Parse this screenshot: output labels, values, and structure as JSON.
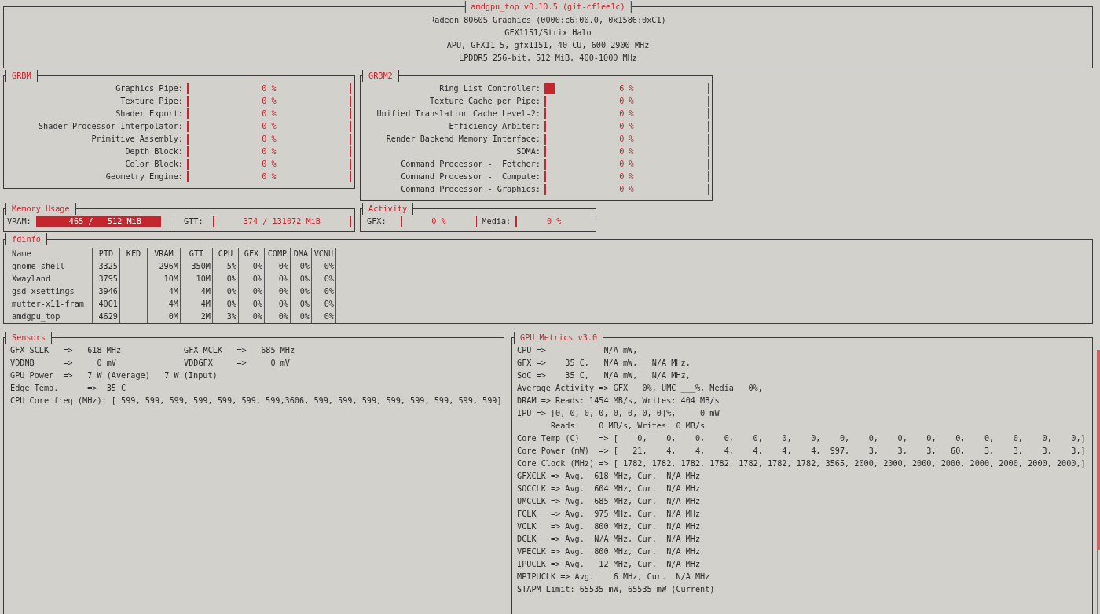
{
  "header": {
    "title": "amdgpu_top v0.10.5 (git-cf1ee1c)",
    "lines": [
      "Radeon 8060S Graphics (0000:c6:00.0, 0x1586:0xC1)",
      "GFX1151/Strix Halo",
      "APU, GFX11_5, gfx1151, 40 CU, 600-2900 MHz",
      "LPDDR5 256-bit, 512 MiB, 400-1000 MHz"
    ]
  },
  "grbm": [
    {
      "title": "GRBM",
      "rows": [
        {
          "label": "Graphics Pipe:",
          "reading": "0 %",
          "level": 0
        },
        {
          "label": "Texture Pipe:",
          "reading": "0 %",
          "level": 0
        },
        {
          "label": "Shader Export:",
          "reading": "0 %",
          "level": 0
        },
        {
          "label": "Shader Processor Interpolator:",
          "reading": "0 %",
          "level": 0
        },
        {
          "label": "Primitive Assembly:",
          "reading": "0 %",
          "level": 0
        },
        {
          "label": "Depth Block:",
          "reading": "0 %",
          "level": 0
        },
        {
          "label": "Color Block:",
          "reading": "0 %",
          "level": 0
        },
        {
          "label": "Geometry Engine:",
          "reading": "0 %",
          "level": 0
        }
      ]
    },
    {
      "title": "GRBM2",
      "rows": [
        {
          "label": "Ring List Controller:",
          "reading": "6 %",
          "level": 0.06
        },
        {
          "label": "Texture Cache per Pipe:",
          "reading": "0 %",
          "level": 0
        },
        {
          "label": "Unified Translation Cache Level-2:",
          "reading": "0 %",
          "level": 0
        },
        {
          "label": "Efficiency Arbiter:",
          "reading": "0 %",
          "level": 0
        },
        {
          "label": "Render Backend Memory Interface:",
          "reading": "0 %",
          "level": 0
        },
        {
          "label": "SDMA:",
          "reading": "0 %",
          "level": 0
        },
        {
          "label": "Command Processor -  Fetcher:",
          "reading": "0 %",
          "level": 0
        },
        {
          "label": "Command Processor -  Compute:",
          "reading": "0 %",
          "level": 0
        },
        {
          "label": "Command Processor - Graphics:",
          "reading": "0 %",
          "level": 0
        }
      ]
    }
  ],
  "memory": {
    "title": "Memory Usage",
    "items": [
      {
        "label": "VRAM:",
        "reading": "465 /   512 MiB",
        "level": 0.91
      },
      {
        "label": "GTT:",
        "reading": "374 / 131072 MiB",
        "level": 0.003
      }
    ]
  },
  "activity": {
    "title": "Activity",
    "items": [
      {
        "label": "GFX:",
        "reading": "0 %",
        "level": 0
      },
      {
        "label": "Media:",
        "reading": "0 %",
        "level": 0
      }
    ]
  },
  "fdinfo": {
    "title": "fdinfo",
    "columns": [
      "Name",
      "PID",
      "KFD",
      "VRAM",
      "GTT",
      "CPU",
      "GFX",
      "COMP",
      "DMA",
      "VCNU"
    ],
    "rows": [
      [
        "gnome-shell",
        "3325",
        "",
        "296M",
        "350M",
        "5%",
        "0%",
        "0%",
        "0%",
        "0%"
      ],
      [
        "Xwayland",
        "3795",
        "",
        "10M",
        "10M",
        "0%",
        "0%",
        "0%",
        "0%",
        "0%"
      ],
      [
        "gsd-xsettings",
        "3946",
        "",
        "4M",
        "4M",
        "0%",
        "0%",
        "0%",
        "0%",
        "0%"
      ],
      [
        "mutter-x11-fram",
        "4001",
        "",
        "4M",
        "4M",
        "0%",
        "0%",
        "0%",
        "0%",
        "0%"
      ],
      [
        "amdgpu_top",
        "4629",
        "",
        "0M",
        "2M",
        "3%",
        "0%",
        "0%",
        "0%",
        "0%"
      ]
    ]
  },
  "sensors": {
    "title": "Sensors",
    "rows": [
      [
        "GFX_SCLK   =>   618 MHz",
        "GFX_MCLK   =>   685 MHz"
      ],
      [
        "VDDNB      =>     0 mV",
        "VDDGFX     =>     0 mV"
      ],
      [
        "GPU Power  =>   7 W (Average)   7 W (Input)"
      ],
      [
        "Edge Temp.      =>  35 C"
      ],
      [
        "CPU Core freq (MHz): [ 599, 599, 599, 599, 599, 599, 599,3606, 599, 599, 599, 599, 599, 599, 599, 599]"
      ]
    ]
  },
  "gpu_metrics": {
    "title": "GPU Metrics v3.0",
    "lines": [
      "CPU =>            N/A mW,",
      "GFX =>    35 C,   N/A mW,   N/A MHz,",
      "SoC =>    35 C,   N/A mW,   N/A MHz,",
      "Average Activity => GFX   0%, UMC ___%, Media   0%,",
      "DRAM => Reads: 1454 MB/s, Writes: 404 MB/s",
      "IPU => [0, 0, 0, 0, 0, 0, 0, 0]%,     0 mW",
      "       Reads:    0 MB/s, Writes: 0 MB/s",
      "Core Temp (C)    => [    0,    0,    0,    0,    0,    0,    0,    0,    0,    0,    0,    0,    0,    0,    0,    0,]",
      "Core Power (mW)  => [   21,    4,    4,    4,    4,    4,    4,  997,    3,    3,    3,   60,    3,    3,    3,    3,]",
      "Core Clock (MHz) => [ 1782, 1782, 1782, 1782, 1782, 1782, 1782, 3565, 2000, 2000, 2000, 2000, 2000, 2000, 2000, 2000,]",
      "GFXCLK => Avg.  618 MHz, Cur.  N/A MHz",
      "SOCCLK => Avg.  604 MHz, Cur.  N/A MHz",
      "UMCCLK => Avg.  685 MHz, Cur.  N/A MHz",
      "FCLK   => Avg.  975 MHz, Cur.  N/A MHz",
      "VCLK   => Avg.  800 MHz, Cur.  N/A MHz",
      "DCLK   => Avg.  N/A MHz, Cur.  N/A MHz",
      "VPECLK => Avg.  800 MHz, Cur.  N/A MHz",
      "IPUCLK => Avg.   12 MHz, Cur.  N/A MHz",
      "MPIPUCLK => Avg.    6 MHz, Cur.  N/A MHz",
      "STAPM Limit: 65535 mW, 65535 mW (Current)"
    ]
  }
}
